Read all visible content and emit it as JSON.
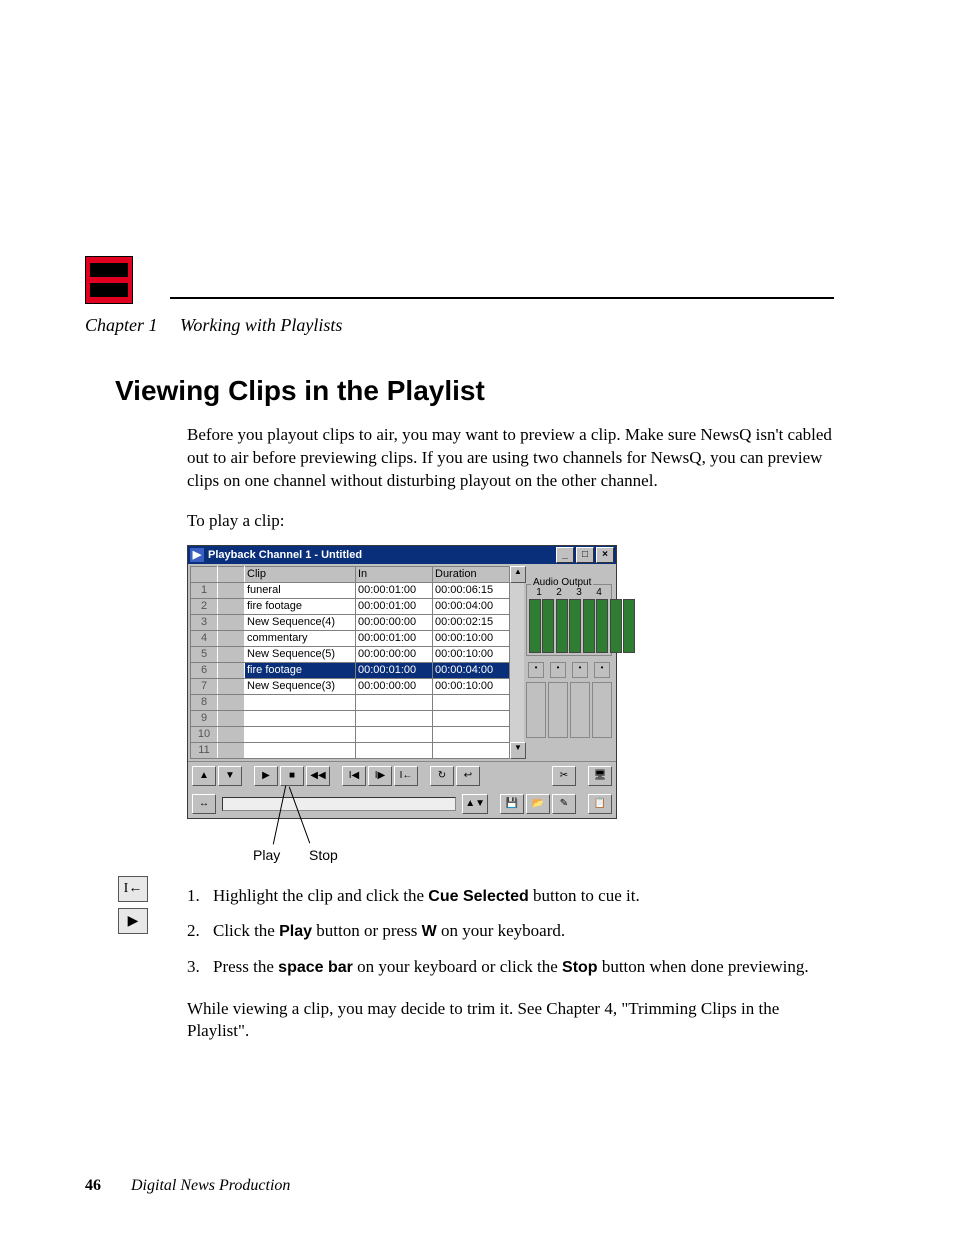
{
  "chapter": {
    "label": "Chapter 1",
    "title": "Working with Playlists"
  },
  "heading": "Viewing Clips in the Playlist",
  "intro": "Before you playout clips to air, you may want to preview a clip. Make sure NewsQ isn't cabled out to air before previewing clips. If you are using two channels for NewsQ, you can preview clips on one channel without disturbing playout on the other channel.",
  "to_play": "To play a clip:",
  "steps": {
    "s1_a": "Highlight the clip and click the ",
    "s1_b": "Cue Selected",
    "s1_c": " button to cue it.",
    "s2_a": "Click the ",
    "s2_b": "Play",
    "s2_c": " button or press ",
    "s2_d": "W",
    "s2_e": " on your keyboard.",
    "s3_a": "Press the ",
    "s3_b": "space bar",
    "s3_c": " on your keyboard or click the ",
    "s3_d": "Stop",
    "s3_e": " button when done previewing."
  },
  "outro": "While viewing a clip, you may decide to trim it. See Chapter 4, \"Trimming Clips in the Playlist\".",
  "footer": {
    "page": "46",
    "book": "Digital News Production"
  },
  "callouts": {
    "play": "Play",
    "stop": "Stop"
  },
  "window": {
    "title": "Playback Channel 1 - Untitled",
    "columns": {
      "clip": "Clip",
      "in": "In",
      "dur": "Duration"
    },
    "rows": [
      {
        "n": "1",
        "clip": "funeral",
        "in": "00:00:01:00",
        "dur": "00:00:06:15"
      },
      {
        "n": "2",
        "clip": "fire footage",
        "in": "00:00:01:00",
        "dur": "00:00:04:00"
      },
      {
        "n": "3",
        "clip": "New Sequence(4)",
        "in": "00:00:00:00",
        "dur": "00:00:02:15"
      },
      {
        "n": "4",
        "clip": "commentary",
        "in": "00:00:01:00",
        "dur": "00:00:10:00"
      },
      {
        "n": "5",
        "clip": "New Sequence(5)",
        "in": "00:00:00:00",
        "dur": "00:00:10:00"
      },
      {
        "n": "6",
        "clip": "fire footage",
        "in": "00:00:01:00",
        "dur": "00:00:04:00",
        "selected": true
      },
      {
        "n": "7",
        "clip": "New Sequence(3)",
        "in": "00:00:00:00",
        "dur": "00:00:10:00"
      },
      {
        "n": "8",
        "clip": "",
        "in": "",
        "dur": ""
      },
      {
        "n": "9",
        "clip": "",
        "in": "",
        "dur": ""
      },
      {
        "n": "10",
        "clip": "",
        "in": "",
        "dur": ""
      },
      {
        "n": "11",
        "clip": "",
        "in": "",
        "dur": ""
      }
    ],
    "audio": {
      "label": "Audio Output",
      "channels": [
        "1",
        "2",
        "3",
        "4"
      ]
    },
    "buttons": {
      "min": "_",
      "max": "□",
      "close": "×",
      "up": "▲",
      "down": "▼",
      "play": "▶",
      "stop": "■",
      "rew": "◀◀",
      "cue_prev": "I◀",
      "cue_next": "I▶",
      "goto_start": "I←",
      "loop": "↻",
      "return": "↩",
      "cut": "✂",
      "expand": "↔",
      "spin": "▲▼",
      "save": "💾",
      "open": "📂",
      "tool": "✎",
      "monitor": "🖥",
      "clipboard": "📋"
    }
  }
}
